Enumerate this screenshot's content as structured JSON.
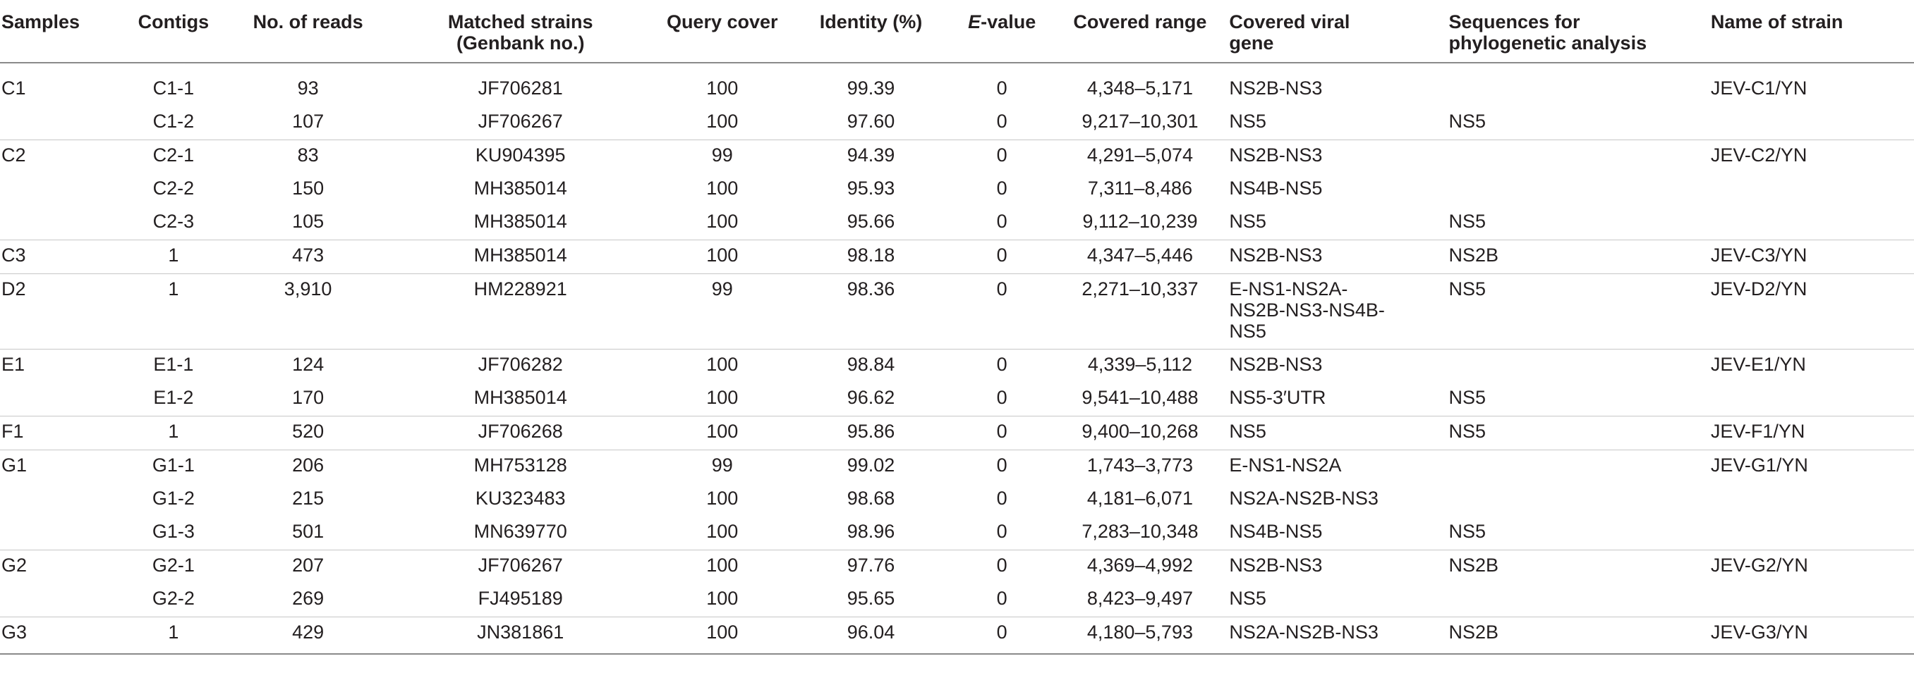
{
  "table": {
    "headers": {
      "samples": "Samples",
      "contigs": "Contigs",
      "reads": "No. of reads",
      "matched_l1": "Matched strains",
      "matched_l2": "(Genbank no.)",
      "query": "Query cover",
      "identity": "Identity (%)",
      "evalue_italic": "E",
      "evalue_rest": "-value",
      "range": "Covered range",
      "gene_l1": "Covered viral",
      "gene_l2": "gene",
      "seq_l1": "Sequences for",
      "seq_l2": "phylogenetic analysis",
      "strain": "Name of strain"
    },
    "rows": [
      {
        "sample": "C1",
        "contig": "C1-1",
        "reads": "93",
        "matched": "JF706281",
        "query": "100",
        "identity": "99.39",
        "evalue": "0",
        "range": "4,348–5,171",
        "gene": "NS2B-NS3",
        "seq": "",
        "strain": "JEV-C1/YN"
      },
      {
        "sample": "",
        "contig": "C1-2",
        "reads": "107",
        "matched": "JF706267",
        "query": "100",
        "identity": "97.60",
        "evalue": "0",
        "range": "9,217–10,301",
        "gene": "NS5",
        "seq": "NS5",
        "strain": ""
      },
      {
        "sample": "C2",
        "contig": "C2-1",
        "reads": "83",
        "matched": "KU904395",
        "query": "99",
        "identity": "94.39",
        "evalue": "0",
        "range": "4,291–5,074",
        "gene": "NS2B-NS3",
        "seq": "",
        "strain": "JEV-C2/YN"
      },
      {
        "sample": "",
        "contig": "C2-2",
        "reads": "150",
        "matched": "MH385014",
        "query": "100",
        "identity": "95.93",
        "evalue": "0",
        "range": "7,311–8,486",
        "gene": "NS4B-NS5",
        "seq": "",
        "strain": ""
      },
      {
        "sample": "",
        "contig": "C2-3",
        "reads": "105",
        "matched": "MH385014",
        "query": "100",
        "identity": "95.66",
        "evalue": "0",
        "range": "9,112–10,239",
        "gene": "NS5",
        "seq": "NS5",
        "strain": ""
      },
      {
        "sample": "C3",
        "contig": "1",
        "reads": "473",
        "matched": "MH385014",
        "query": "100",
        "identity": "98.18",
        "evalue": "0",
        "range": "4,347–5,446",
        "gene": "NS2B-NS3",
        "seq": "NS2B",
        "strain": "JEV-C3/YN"
      },
      {
        "sample": "D2",
        "contig": "1",
        "reads": "3,910",
        "matched": "HM228921",
        "query": "99",
        "identity": "98.36",
        "evalue": "0",
        "range": "2,271–10,337",
        "gene_lines": [
          "E-NS1-NS2A-",
          "NS2B-NS3-NS4B-",
          "NS5"
        ],
        "seq": "NS5",
        "strain": "JEV-D2/YN"
      },
      {
        "sample": "E1",
        "contig": "E1-1",
        "reads": "124",
        "matched": "JF706282",
        "query": "100",
        "identity": "98.84",
        "evalue": "0",
        "range": "4,339–5,112",
        "gene": "NS2B-NS3",
        "seq": "",
        "strain": "JEV-E1/YN"
      },
      {
        "sample": "",
        "contig": "E1-2",
        "reads": "170",
        "matched": "MH385014",
        "query": "100",
        "identity": "96.62",
        "evalue": "0",
        "range": "9,541–10,488",
        "gene": "NS5-3′UTR",
        "seq": "NS5",
        "strain": ""
      },
      {
        "sample": "F1",
        "contig": "1",
        "reads": "520",
        "matched": "JF706268",
        "query": "100",
        "identity": "95.86",
        "evalue": "0",
        "range": "9,400–10,268",
        "gene": "NS5",
        "seq": "NS5",
        "strain": "JEV-F1/YN"
      },
      {
        "sample": "G1",
        "contig": "G1-1",
        "reads": "206",
        "matched": "MH753128",
        "query": "99",
        "identity": "99.02",
        "evalue": "0",
        "range": "1,743–3,773",
        "gene": "E-NS1-NS2A",
        "seq": "",
        "strain": "JEV-G1/YN"
      },
      {
        "sample": "",
        "contig": "G1-2",
        "reads": "215",
        "matched": "KU323483",
        "query": "100",
        "identity": "98.68",
        "evalue": "0",
        "range": "4,181–6,071",
        "gene": "NS2A-NS2B-NS3",
        "seq": "",
        "strain": ""
      },
      {
        "sample": "",
        "contig": "G1-3",
        "reads": "501",
        "matched": "MN639770",
        "query": "100",
        "identity": "98.96",
        "evalue": "0",
        "range": "7,283–10,348",
        "gene": "NS4B-NS5",
        "seq": "NS5",
        "strain": ""
      },
      {
        "sample": "G2",
        "contig": "G2-1",
        "reads": "207",
        "matched": "JF706267",
        "query": "100",
        "identity": "97.76",
        "evalue": "0",
        "range": "4,369–4,992",
        "gene": "NS2B-NS3",
        "seq": "NS2B",
        "strain": "JEV-G2/YN"
      },
      {
        "sample": "",
        "contig": "G2-2",
        "reads": "269",
        "matched": "FJ495189",
        "query": "100",
        "identity": "95.65",
        "evalue": "0",
        "range": "8,423–9,497",
        "gene": "NS5",
        "seq": "",
        "strain": ""
      },
      {
        "sample": "G3",
        "contig": "1",
        "reads": "429",
        "matched": "JN381861",
        "query": "100",
        "identity": "96.04",
        "evalue": "0",
        "range": "4,180–5,793",
        "gene": "NS2A-NS2B-NS3",
        "seq": "NS2B",
        "strain": "JEV-G3/YN"
      }
    ]
  }
}
